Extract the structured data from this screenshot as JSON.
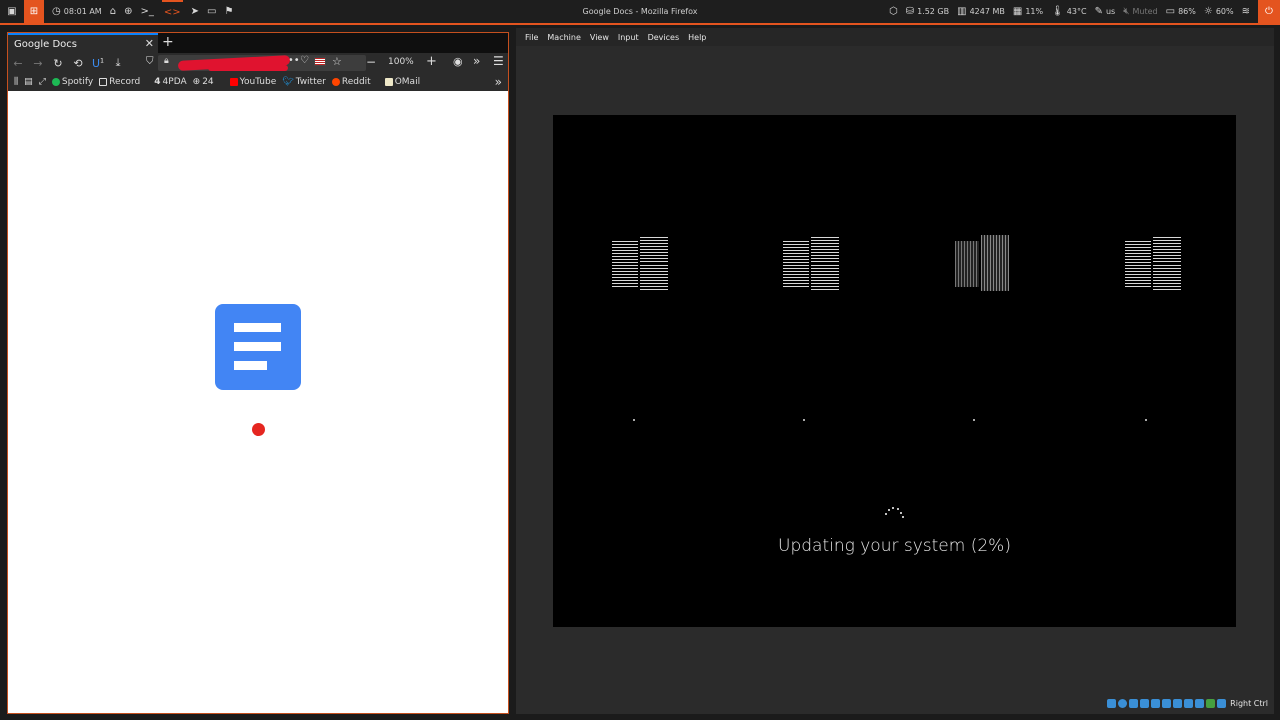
{
  "topbar": {
    "time": "08:01 AM",
    "window_title": "Google Docs - Mozilla Firefox",
    "disk": "1.52 GB",
    "memory": "4247 MB",
    "cpu": "11%",
    "temperature": "43°C",
    "keyboard_layout": "us",
    "volume": "Muted",
    "brightness": "86%",
    "battery": "60%",
    "accent_color": "#e4541f"
  },
  "firefox": {
    "tab_title": "Google Docs",
    "extension_badge": "1",
    "zoom": "100%",
    "bookmarks": [
      "Spotify",
      "Record",
      "4PDA",
      "24",
      "YouTube",
      "Twitter",
      "Reddit",
      "OMail"
    ],
    "brand_color": "#4285f4"
  },
  "virtualbox": {
    "menu": [
      "File",
      "Machine",
      "View",
      "Input",
      "Devices",
      "Help"
    ],
    "status_text": "Updating your system (2%)",
    "host_key": "Right Ctrl"
  }
}
